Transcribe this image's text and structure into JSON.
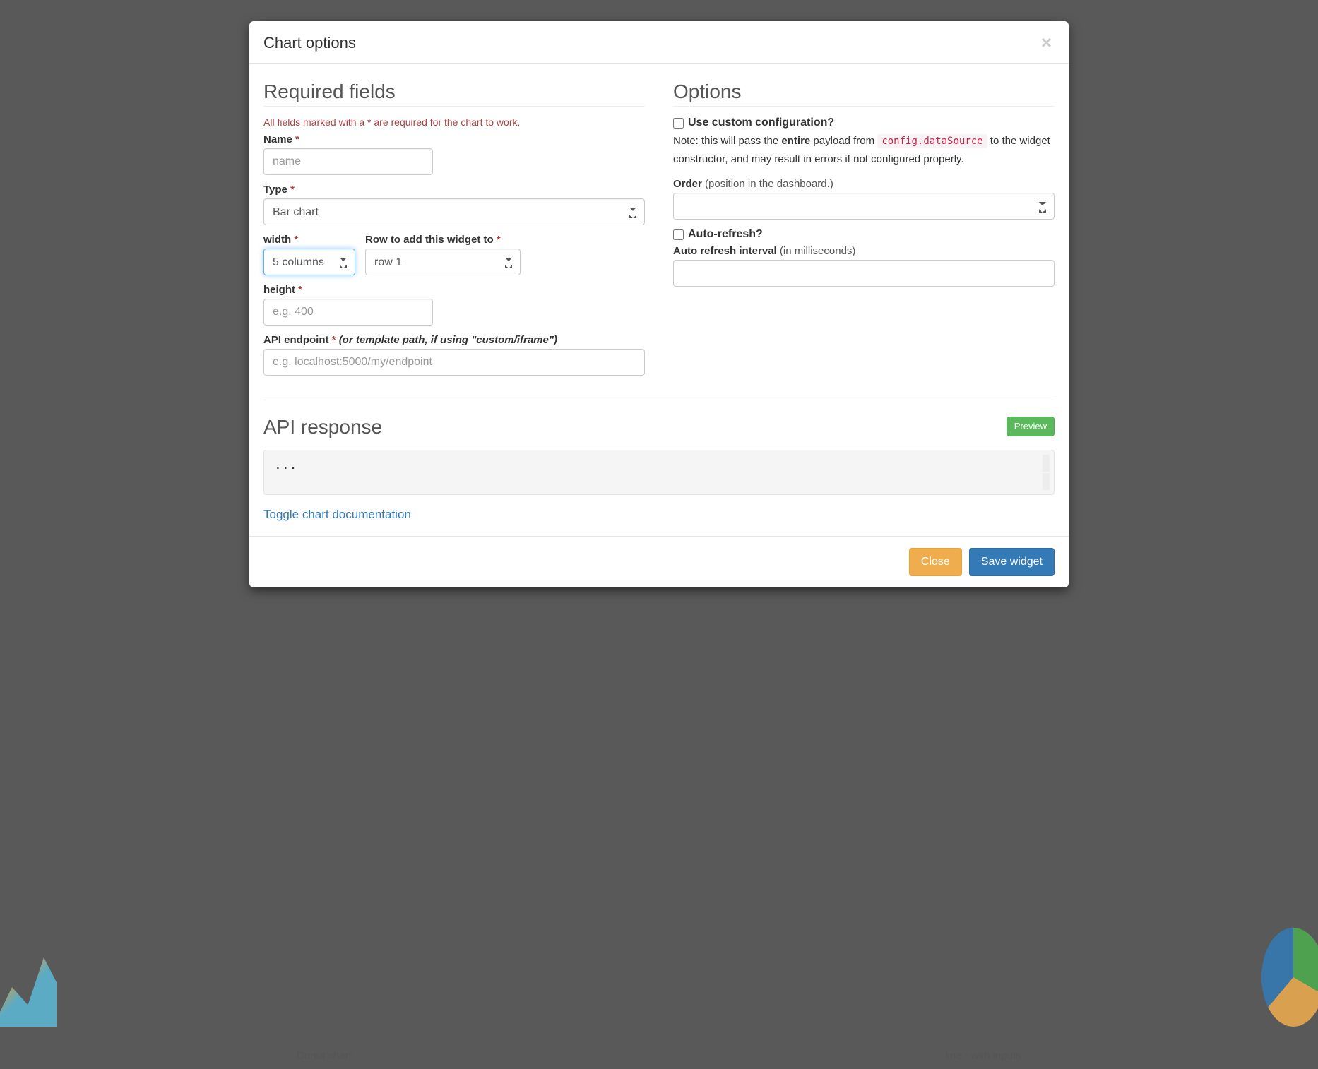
{
  "modal": {
    "title": "Chart options",
    "close_glyph": "×"
  },
  "required": {
    "heading": "Required fields",
    "helper": "All fields marked with a * are required for the chart to work.",
    "name": {
      "label": "Name",
      "placeholder": "name",
      "value": ""
    },
    "type": {
      "label": "Type",
      "value": "Bar chart"
    },
    "width": {
      "label": "width",
      "value": "5 columns"
    },
    "row": {
      "label": "Row to add this widget to",
      "value": "row 1"
    },
    "height": {
      "label": "height",
      "placeholder": "e.g. 400",
      "value": ""
    },
    "endpoint": {
      "label": "API endpoint",
      "hint_italic": "(or template path, if using \"custom/iframe\")",
      "placeholder": "e.g. localhost:5000/my/endpoint",
      "value": ""
    }
  },
  "options": {
    "heading": "Options",
    "custom_config": {
      "label": "Use custom configuration?",
      "checked": false
    },
    "note_prefix": "Note: this will pass the ",
    "note_bold": "entire",
    "note_mid": " payload from ",
    "note_code": "config.dataSource",
    "note_suffix": " to the widget constructor, and may result in errors if not configured properly.",
    "order": {
      "label": "Order",
      "hint": "(position in the dashboard.)",
      "value": ""
    },
    "autorefresh": {
      "label": "Auto-refresh?",
      "checked": false
    },
    "interval": {
      "label": "Auto refresh interval",
      "hint": "(in milliseconds)",
      "value": ""
    }
  },
  "api": {
    "heading": "API response",
    "preview_label": "Preview",
    "response_text": "...",
    "toggle_docs": "Toggle chart documentation"
  },
  "footer": {
    "close": "Close",
    "save": "Save widget"
  },
  "background": {
    "left_caption": "Donut chart",
    "right_caption": "line - with inputs"
  }
}
